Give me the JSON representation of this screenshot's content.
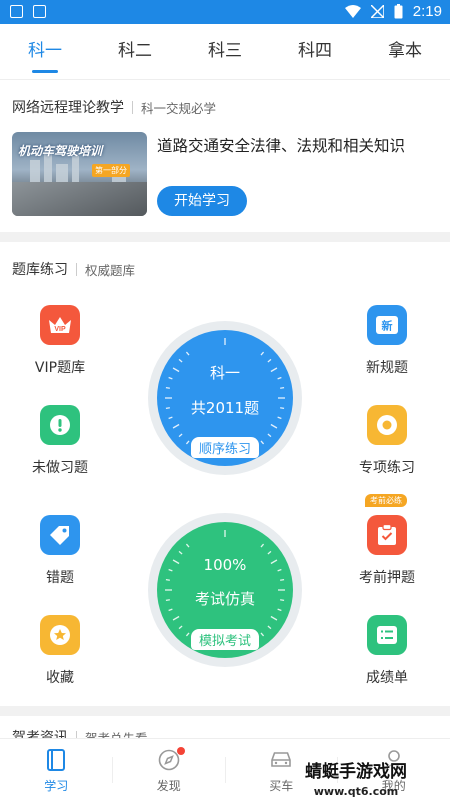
{
  "status_bar": {
    "time": "2:19"
  },
  "tabs": [
    "科一",
    "科二",
    "科三",
    "科四",
    "拿本"
  ],
  "remote_section": {
    "title": "网络远程理论教学",
    "subtitle": "科一交规必学",
    "course": {
      "image_title": "机动车驾驶培训",
      "image_badge": "第一部分",
      "description": "道路交通安全法律、法规和相关知识",
      "button": "开始学习"
    }
  },
  "practice_section": {
    "title": "题库练习",
    "subtitle": "权威题库",
    "left_items": [
      "VIP题库",
      "未做习题",
      "错题",
      "收藏"
    ],
    "right_items": [
      "新规题",
      "专项练习",
      "考前押题",
      "成绩单"
    ],
    "hint_tag": "考前必练",
    "gauge_order": {
      "line1": "科一",
      "line2": "共2011题",
      "button": "顺序练习",
      "color": "#2e95ee"
    },
    "gauge_exam": {
      "line1": "100%",
      "line2": "考试仿真",
      "button": "模拟考试",
      "color": "#2ec27e"
    }
  },
  "next_section": {
    "title": "驾考资讯",
    "subtitle": "驾考总先看"
  },
  "bottom_nav": [
    "学习",
    "发现",
    "买车",
    "我的"
  ],
  "watermark": {
    "line1": "蜻蜓手游戏网",
    "line2": "www.qt6.com"
  }
}
